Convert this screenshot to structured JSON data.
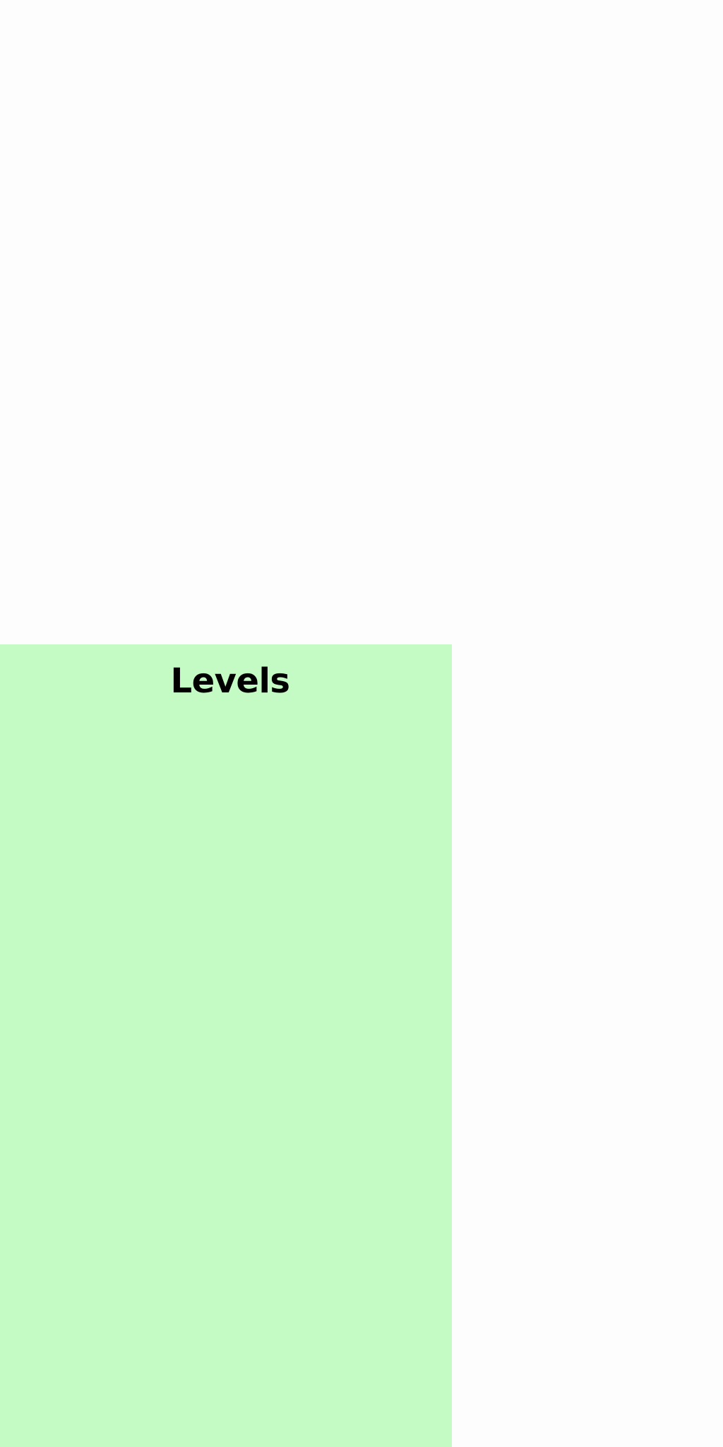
{
  "levels_panel": {
    "title": "Levels",
    "background_color": "#c4fac4",
    "title_color": "#000000"
  },
  "page": {
    "background_color": "#fdfdfd"
  }
}
